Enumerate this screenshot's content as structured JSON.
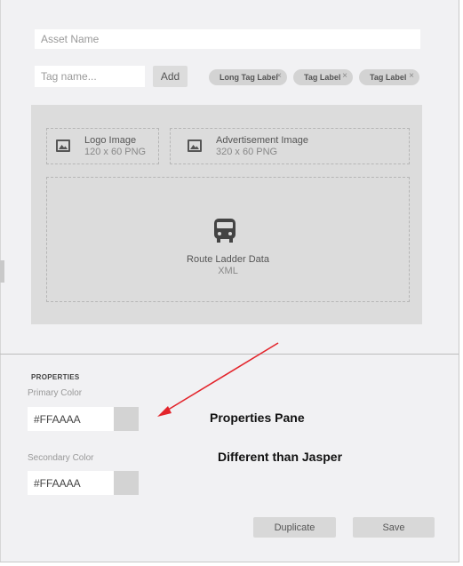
{
  "asset": {
    "name_placeholder": "Asset Name"
  },
  "tags": {
    "input_placeholder": "Tag name...",
    "add_label": "Add",
    "items": [
      {
        "label": "Long Tag Label",
        "remove": "×"
      },
      {
        "label": "Tag Label",
        "remove": "×"
      },
      {
        "label": "Tag Label",
        "remove": "×"
      }
    ]
  },
  "uploads": {
    "logo": {
      "title": "Logo Image",
      "subtitle": "120 x 60 PNG",
      "icon": "image-icon"
    },
    "advertisement": {
      "title": "Advertisement Image",
      "subtitle": "320 x 60 PNG",
      "icon": "image-icon"
    },
    "route": {
      "title": "Route Ladder Data",
      "subtitle": "XML",
      "icon": "bus-icon"
    }
  },
  "properties": {
    "heading": "PROPERTIES",
    "primary": {
      "label": "Primary Color",
      "value": "#FFAAAA"
    },
    "secondary": {
      "label": "Secondary Color",
      "value": "#FFAAAA"
    }
  },
  "annotations": {
    "line1": "Properties Pane",
    "line2": "Different than Jasper",
    "arrow_color": "#e3242b"
  },
  "actions": {
    "duplicate": "Duplicate",
    "save": "Save"
  }
}
